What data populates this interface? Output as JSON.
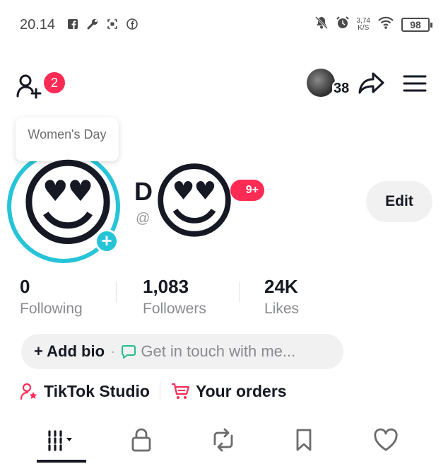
{
  "status_bar": {
    "time": "20.14",
    "icons_left": [
      "facebook-icon",
      "wrench-icon",
      "screenshot-icon",
      "facebook-messenger-icon"
    ],
    "icons_right": [
      "mute-notifications-icon",
      "alarm-icon",
      "wifi-icon"
    ],
    "speed_value": "3,74",
    "speed_unit": "K/S",
    "battery": "98"
  },
  "top_bar": {
    "notification_count": "2",
    "viewers_count": "38"
  },
  "profile": {
    "tag": "Women's Day",
    "name_initial": "D",
    "handle_prefix": "@",
    "inbox_badge": "9+",
    "edit_label": "Edit",
    "add_avatar_symbol": "+",
    "emoji": "😍"
  },
  "stats": [
    {
      "value": "0",
      "label": "Following"
    },
    {
      "value": "1,083",
      "label": "Followers"
    },
    {
      "value": "24K",
      "label": "Likes"
    }
  ],
  "bio": {
    "add_bio_label": "+ Add bio",
    "separator": "·",
    "contact_label": "Get in touch with me..."
  },
  "links": {
    "studio_label": "TikTok Studio",
    "orders_label": "Your orders"
  },
  "tabs": [
    "videos-grid-icon",
    "private-lock-icon",
    "repost-icon",
    "bookmark-icon",
    "liked-heart-icon"
  ],
  "colors": {
    "accent_red": "#fe2c55",
    "ring_cyan": "#27c4d8",
    "text_dark": "#161823",
    "text_muted": "#8a8b91",
    "pill_bg": "#f1f1f2"
  }
}
